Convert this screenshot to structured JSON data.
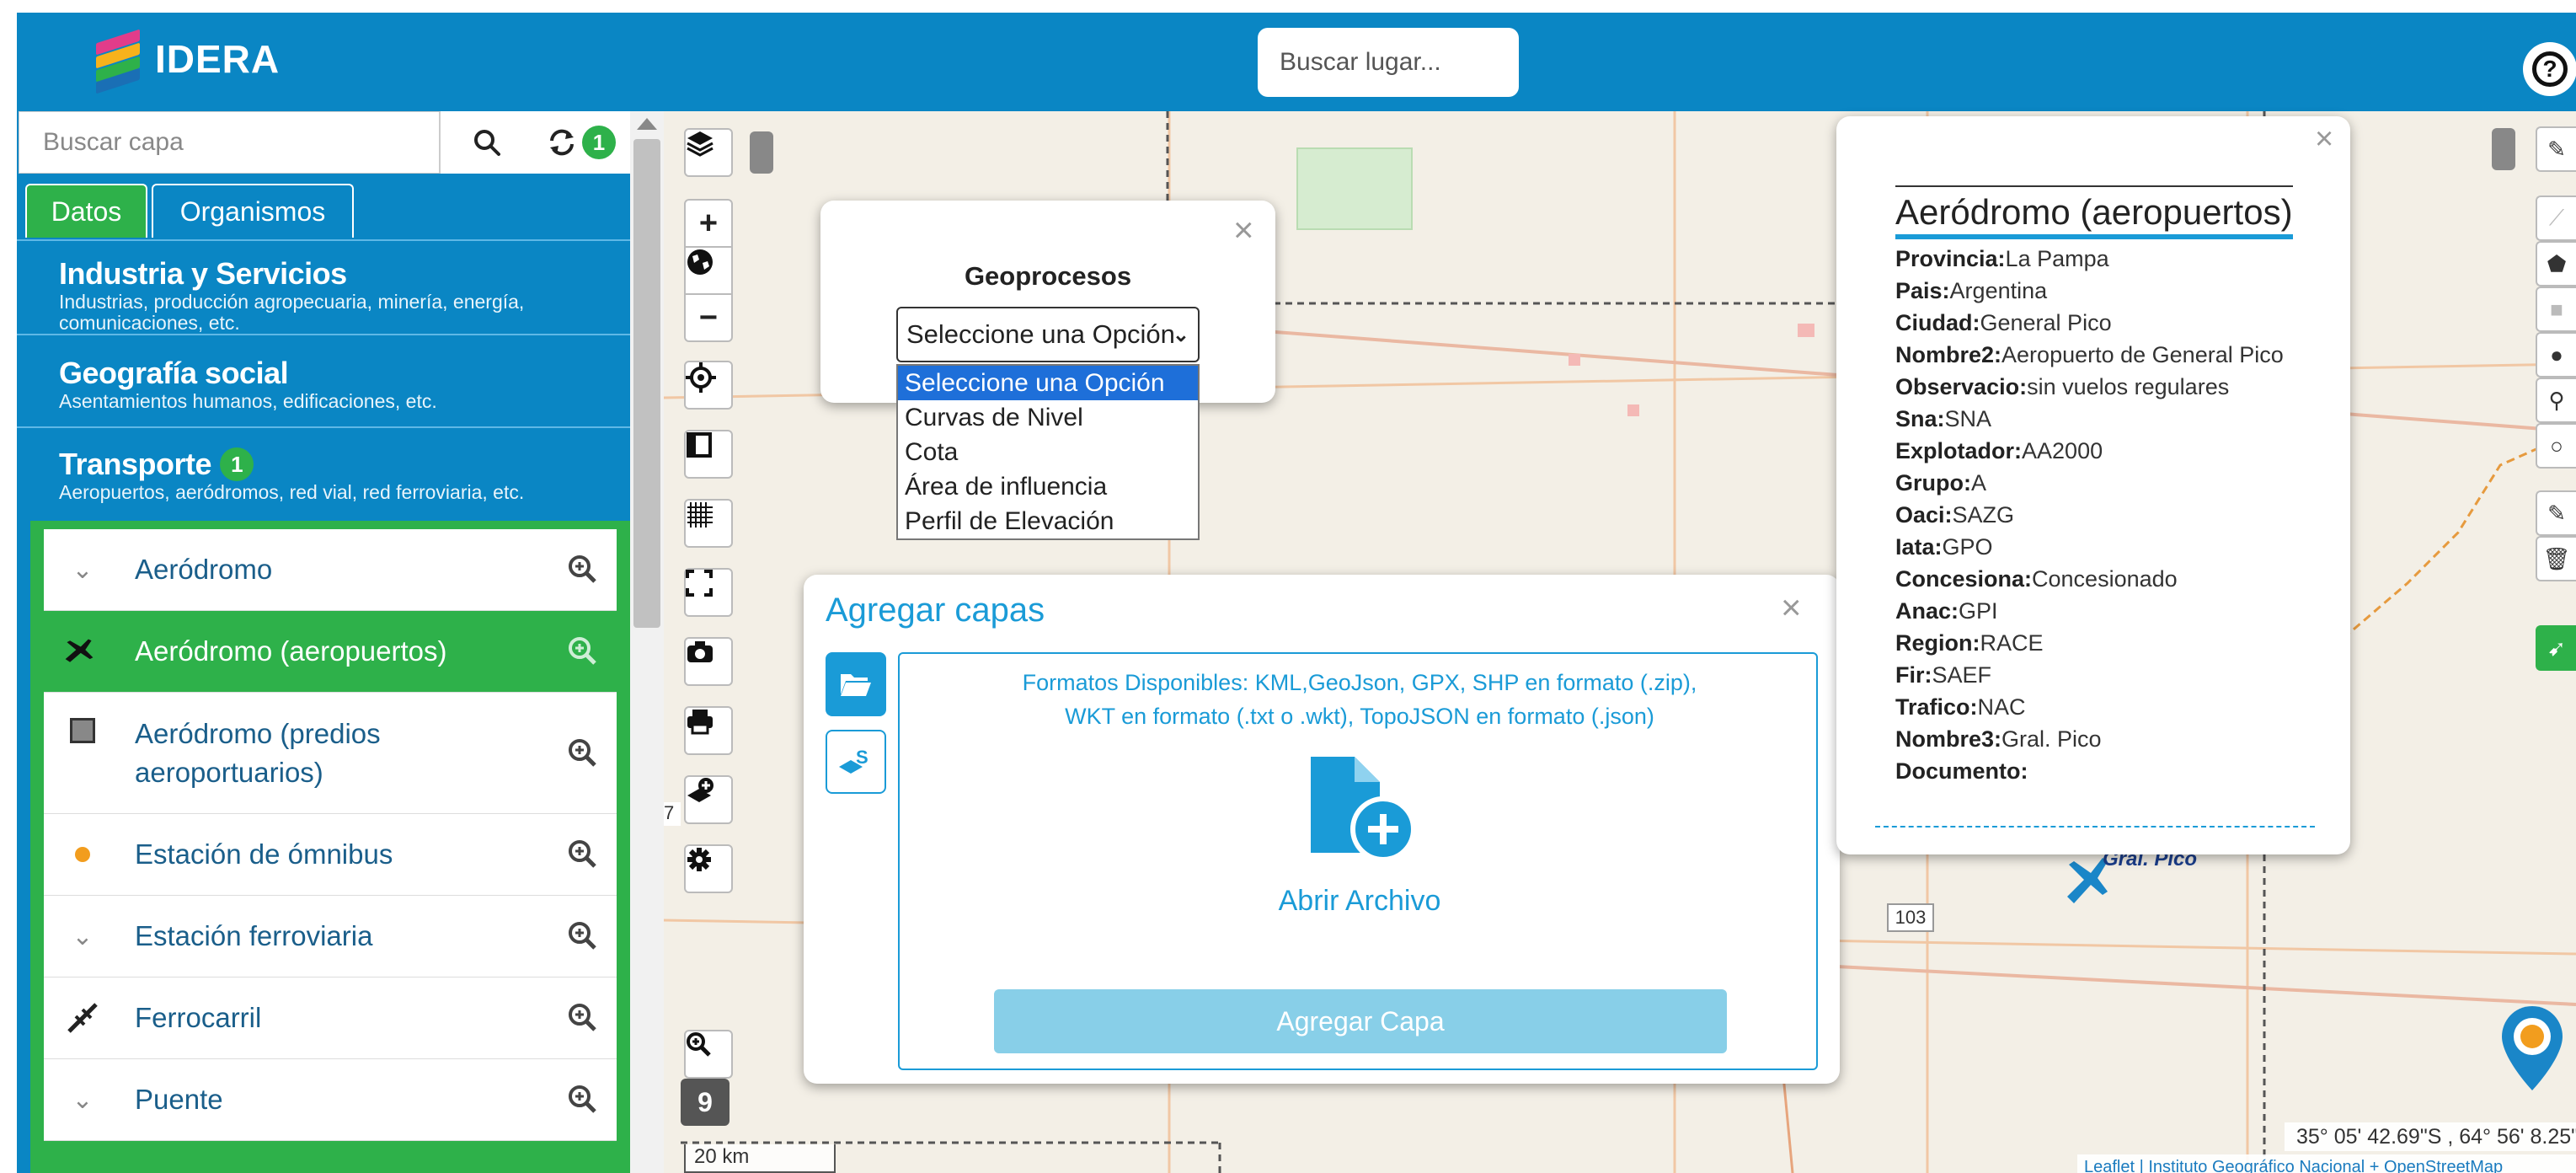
{
  "header": {
    "logo_text": "IDERA",
    "search_placeholder": "Buscar lugar...",
    "help_icon": "question-icon"
  },
  "sidebar": {
    "search_placeholder": "Buscar capa",
    "refresh_badge": "1",
    "tabs": [
      "Datos",
      "Organismos"
    ],
    "categories": [
      {
        "title": "Industria y Servicios",
        "desc": "Industrias, producción agropecuaria, minería, energía, comunicaciones, etc."
      },
      {
        "title": "Geografía social",
        "desc": "Asentamientos humanos, edificaciones, etc."
      },
      {
        "title": "Transporte",
        "badge": "1",
        "desc": "Aeropuertos, aeródromos, red vial, red ferroviaria, etc."
      }
    ],
    "layers": [
      {
        "label": "Aeródromo",
        "icon": "chevron-down-icon"
      },
      {
        "label": "Aeródromo (aeropuertos)",
        "icon": "airplane-icon",
        "active": true
      },
      {
        "label": "Aeródromo (predios aeroportuarios)",
        "icon": "square-icon"
      },
      {
        "label": "Estación de ómnibus",
        "icon": "dot-icon"
      },
      {
        "label": "Estación ferroviaria",
        "icon": "chevron-down-icon"
      },
      {
        "label": "Ferrocarril",
        "icon": "rail-icon"
      },
      {
        "label": "Puente",
        "icon": "chevron-down-icon"
      }
    ]
  },
  "map": {
    "zoom_level": "9",
    "scale": "20 km",
    "road_label": "103",
    "place_label": "Gral. Pico",
    "side_number": "7",
    "coords": "35° 05' 42.69\"S , 64° 56' 8.25\"",
    "attribution": "Leaflet | Instituto Geográfico Nacional + OpenStreetMap"
  },
  "geoprocesos": {
    "title": "Geoprocesos",
    "selected": "Seleccione una Opción",
    "options": [
      "Seleccione una Opción",
      "Curvas de Nivel",
      "Cota",
      "Área de influencia",
      "Perfil de Elevación"
    ]
  },
  "agregar": {
    "title": "Agregar capas",
    "formats_line1": "Formatos Disponibles: KML,GeoJson, GPX, SHP en formato (.zip),",
    "formats_line2": "WKT en formato (.txt o .wkt), TopoJSON en formato (.json)",
    "open_file": "Abrir Archivo",
    "add_button": "Agregar Capa"
  },
  "info": {
    "title": "Aeródromo (aeropuertos)",
    "fields": [
      {
        "k": "Provincia:",
        "v": "La Pampa"
      },
      {
        "k": "Pais:",
        "v": "Argentina"
      },
      {
        "k": "Ciudad:",
        "v": "General Pico"
      },
      {
        "k": "Nombre2:",
        "v": "Aeropuerto de General Pico"
      },
      {
        "k": "Observacio:",
        "v": "sin vuelos regulares"
      },
      {
        "k": "Sna:",
        "v": "SNA"
      },
      {
        "k": "Explotador:",
        "v": "AA2000"
      },
      {
        "k": "Grupo:",
        "v": "A"
      },
      {
        "k": "Oaci:",
        "v": "SAZG"
      },
      {
        "k": "Iata:",
        "v": "GPO"
      },
      {
        "k": "Concesiona:",
        "v": "Concesionado"
      },
      {
        "k": "Anac:",
        "v": "GPI"
      },
      {
        "k": "Region:",
        "v": "RACE"
      },
      {
        "k": "Fir:",
        "v": "SAEF"
      },
      {
        "k": "Trafico:",
        "v": "NAC"
      },
      {
        "k": "Nombre3:",
        "v": "Gral. Pico"
      },
      {
        "k": "Documento:",
        "v": ""
      }
    ]
  },
  "colors": {
    "header_blue": "#0a86c4",
    "active_green": "#2eb14a",
    "accent_blue": "#1a9bd7"
  }
}
